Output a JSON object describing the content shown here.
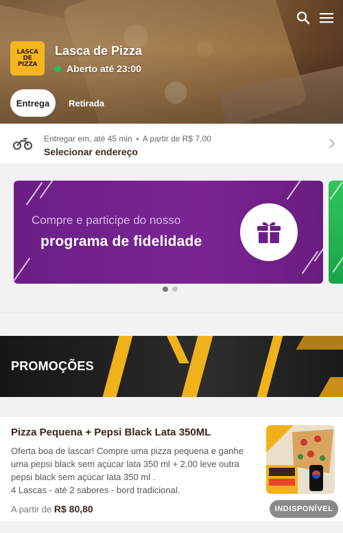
{
  "header": {
    "store_name": "Lasca de Pizza",
    "status": "Aberto até 23:00",
    "status_color": "#1fc65a",
    "logo_text": [
      "LASCA",
      "DE",
      "PIZZA"
    ],
    "icons": [
      "search-icon",
      "menu-icon"
    ]
  },
  "mode_tabs": [
    {
      "label": "Entrega",
      "active": true
    },
    {
      "label": "Retirada",
      "active": false
    }
  ],
  "delivery": {
    "eta": "Entregar em, até 45 min",
    "min_price": "A partir de R$ 7,00",
    "address_action": "Selecionar endereço",
    "icon": "motorcycle-icon"
  },
  "banner": {
    "line1": "Compre e participe do nosso",
    "line2": "programa de fidelidade",
    "icon": "gift-icon",
    "color": "#6b1e86",
    "next_color": "#2fc55a",
    "pager": {
      "count": 2,
      "active": 0
    }
  },
  "promotions": {
    "title": "PROMOÇÕES",
    "accent": "#f0b21b"
  },
  "product": {
    "name": "Pizza Pequena + Pepsi Black Lata 350ML",
    "description_lines": [
      "Oferta boa de lascar! Compre uma pizza pequena e ganhe",
      "uma pepsi black sem açúcar lata 350 ml + 2,00 leve outra",
      "pepsi black sem açúcar lata 350 ml .",
      "4 Lascas - até 2 sabores - bord tradicional."
    ],
    "price_prefix": "A partir de",
    "price": "R$ 80,80",
    "status_badge": "INDISPONÍVEL"
  }
}
